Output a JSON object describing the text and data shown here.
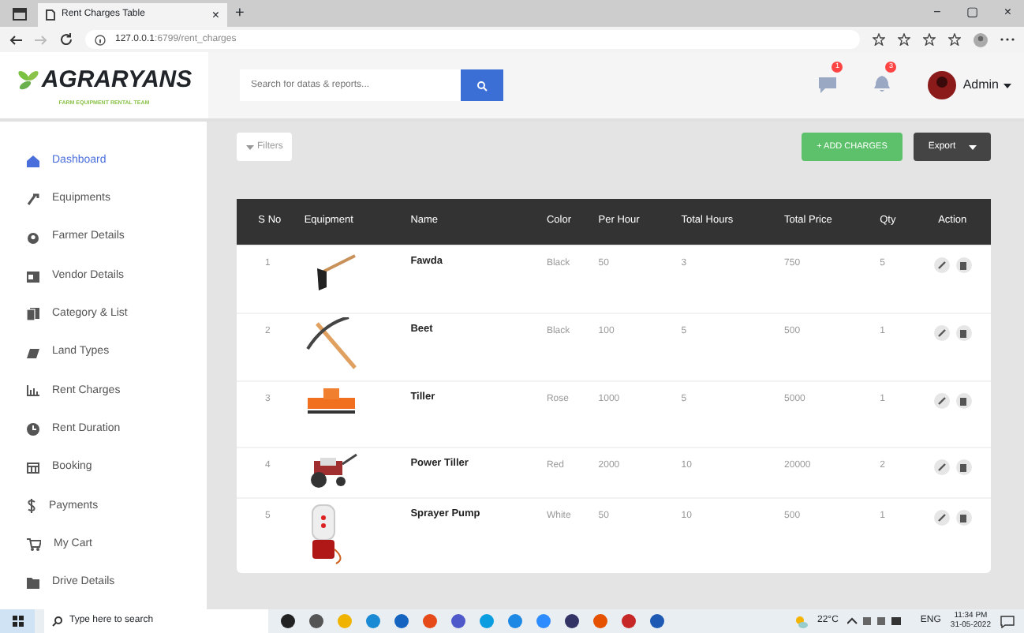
{
  "browser": {
    "tab_title": "Rent Charges Table",
    "tab_close": "×",
    "new_tab": "+",
    "url_host": "127.0.0.1",
    "url_path": ":6799/rent_charges",
    "window_controls": [
      "−",
      "▢",
      "×"
    ]
  },
  "header": {
    "logo": "AGRARYANS",
    "tagline": "FARM EQUIPMENT RENTAL TEAM",
    "search": {
      "placeholder": "Search for datas & reports..."
    },
    "message_badge": "1",
    "bell_badge": "3",
    "user": "Admin"
  },
  "sidebar": {
    "items": [
      {
        "label": "Dashboard",
        "selected": true
      },
      {
        "label": "Equipments",
        "selected": false
      },
      {
        "label": "Farmer Details",
        "selected": false
      },
      {
        "label": "Vendor Details",
        "selected": false
      },
      {
        "label": "Category & List",
        "selected": false
      },
      {
        "label": "Land Types",
        "selected": false
      },
      {
        "label": "Rent Charges",
        "selected": false
      },
      {
        "label": "Rent Duration",
        "selected": false
      },
      {
        "label": "Booking",
        "selected": false
      },
      {
        "label": "Payments",
        "selected": false
      },
      {
        "label": "My Cart",
        "selected": false
      },
      {
        "label": "Drive Details",
        "selected": false
      }
    ]
  },
  "toolbar": {
    "filters": "Filters",
    "add": "+ ADD CHARGES",
    "export": "Export"
  },
  "table": {
    "columns": [
      "S No",
      "Equipment",
      "Name",
      "Color",
      "Per Hour",
      "Total Hours",
      "Total Price",
      "Qty",
      "Action"
    ],
    "rows": [
      {
        "sno": "1",
        "name": "Fawda",
        "color_name": "Black",
        "per_hour": "50",
        "total_hours": "3",
        "total_price": "750",
        "qty": "5"
      },
      {
        "sno": "2",
        "name": "Beet",
        "color_name": "Black",
        "per_hour": "100",
        "total_hours": "5",
        "total_price": "500",
        "qty": "1"
      },
      {
        "sno": "3",
        "name": "Tiller",
        "color_name": "Rose",
        "per_hour": "1000",
        "total_hours": "5",
        "total_price": "5000",
        "qty": "1"
      },
      {
        "sno": "4",
        "name": "Power Tiller",
        "color_name": "Red",
        "per_hour": "2000",
        "total_hours": "10",
        "total_price": "20000",
        "qty": "2"
      },
      {
        "sno": "5",
        "name": "Sprayer Pump",
        "color_name": "White",
        "per_hour": "50",
        "total_hours": "10",
        "total_price": "500",
        "qty": "1"
      }
    ]
  },
  "taskbar": {
    "search_placeholder": "Type here to search",
    "weather": "22°C",
    "language": "ENG",
    "time": "11:34 PM",
    "date": "31-05-2022"
  }
}
